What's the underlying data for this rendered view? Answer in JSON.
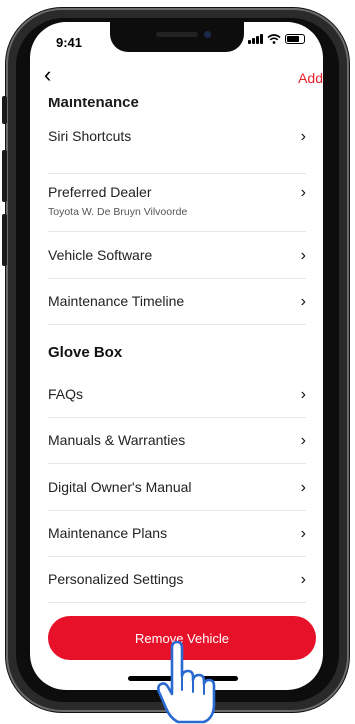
{
  "status": {
    "time": "9:41"
  },
  "nav": {
    "back_glyph": "‹",
    "add_label": "Add"
  },
  "sections": {
    "maintenance": "Maintenance",
    "glove_box": "Glove Box"
  },
  "maintenance_items": [
    {
      "label": "Siri Shortcuts"
    },
    {
      "label": "Preferred Dealer",
      "sub": "Toyota W. De Bruyn Vilvoorde"
    },
    {
      "label": "Vehicle Software"
    },
    {
      "label": "Maintenance Timeline"
    }
  ],
  "glove_items": [
    {
      "label": "FAQs"
    },
    {
      "label": "Manuals & Warranties"
    },
    {
      "label": "Digital Owner's Manual"
    },
    {
      "label": "Maintenance Plans"
    },
    {
      "label": "Personalized Settings"
    }
  ],
  "remove_button": {
    "label": "Remove Vehicle"
  },
  "icons": {
    "chevron": "chevron-right-icon",
    "back": "back-arrow-icon",
    "hand": "hand-pointer-icon"
  },
  "colors": {
    "accent": "#e8212d",
    "button": "#e8112a"
  }
}
